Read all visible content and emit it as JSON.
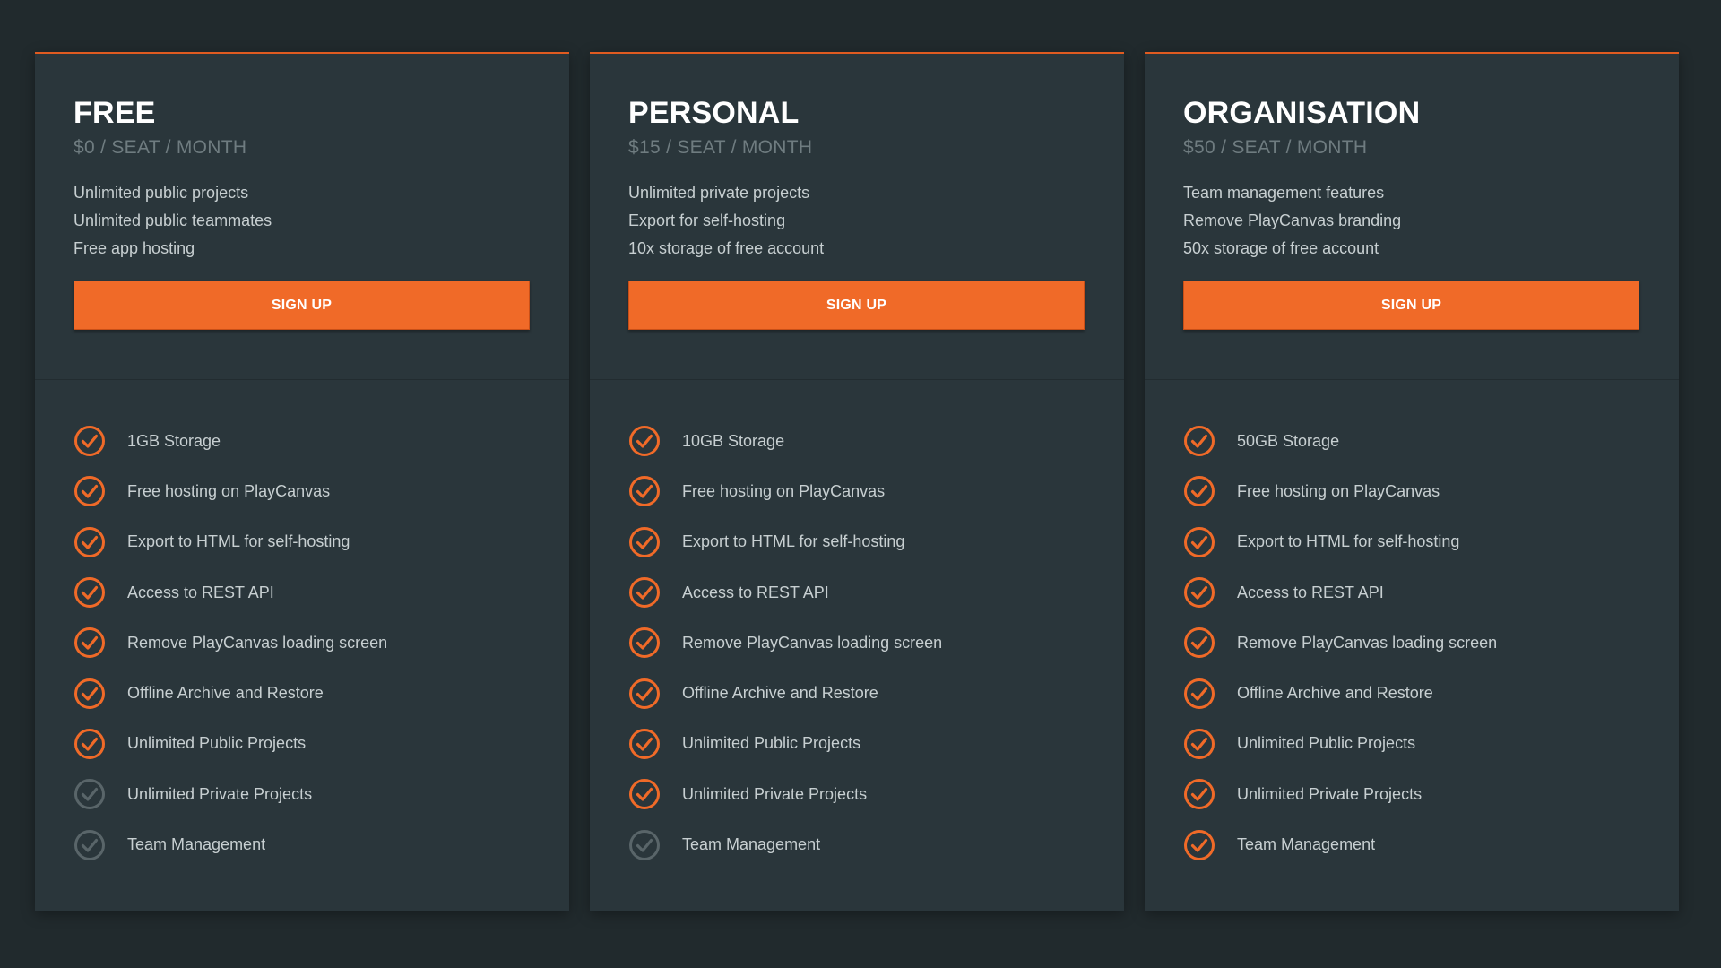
{
  "colors": {
    "background": "#212a2d",
    "card": "#2a363b",
    "accent": "#f06a28",
    "check_included": "#f06a28",
    "check_excluded": "#596569"
  },
  "plans": [
    {
      "name": "FREE",
      "price": "$0 / SEAT / MONTH",
      "highlights": [
        "Unlimited public projects",
        "Unlimited public teammates",
        "Free app hosting"
      ],
      "cta": "SIGN UP",
      "features": [
        {
          "label": "1GB Storage",
          "included": true,
          "icon": "check-circle-icon"
        },
        {
          "label": "Free hosting on PlayCanvas",
          "included": true,
          "icon": "check-circle-icon"
        },
        {
          "label": "Export to HTML for self-hosting",
          "included": true,
          "icon": "check-circle-icon"
        },
        {
          "label": "Access to REST API",
          "included": true,
          "icon": "check-circle-icon"
        },
        {
          "label": "Remove PlayCanvas loading screen",
          "included": true,
          "icon": "check-circle-icon"
        },
        {
          "label": "Offline Archive and Restore",
          "included": true,
          "icon": "check-circle-icon"
        },
        {
          "label": "Unlimited Public Projects",
          "included": true,
          "icon": "check-circle-icon"
        },
        {
          "label": "Unlimited Private Projects",
          "included": false,
          "icon": "check-circle-icon"
        },
        {
          "label": "Team Management",
          "included": false,
          "icon": "check-circle-icon"
        }
      ]
    },
    {
      "name": "PERSONAL",
      "price": "$15 / SEAT / MONTH",
      "highlights": [
        "Unlimited private projects",
        "Export for self-hosting",
        "10x storage of free account"
      ],
      "cta": "SIGN UP",
      "features": [
        {
          "label": "10GB Storage",
          "included": true,
          "icon": "check-circle-icon"
        },
        {
          "label": "Free hosting on PlayCanvas",
          "included": true,
          "icon": "check-circle-icon"
        },
        {
          "label": "Export to HTML for self-hosting",
          "included": true,
          "icon": "check-circle-icon"
        },
        {
          "label": "Access to REST API",
          "included": true,
          "icon": "check-circle-icon"
        },
        {
          "label": "Remove PlayCanvas loading screen",
          "included": true,
          "icon": "check-circle-icon"
        },
        {
          "label": "Offline Archive and Restore",
          "included": true,
          "icon": "check-circle-icon"
        },
        {
          "label": "Unlimited Public Projects",
          "included": true,
          "icon": "check-circle-icon"
        },
        {
          "label": "Unlimited Private Projects",
          "included": true,
          "icon": "check-circle-icon"
        },
        {
          "label": "Team Management",
          "included": false,
          "icon": "check-circle-icon"
        }
      ]
    },
    {
      "name": "ORGANISATION",
      "price": "$50 / SEAT / MONTH",
      "highlights": [
        "Team management features",
        "Remove PlayCanvas branding",
        "50x storage of free account"
      ],
      "cta": "SIGN UP",
      "features": [
        {
          "label": "50GB Storage",
          "included": true,
          "icon": "check-circle-icon"
        },
        {
          "label": "Free hosting on PlayCanvas",
          "included": true,
          "icon": "check-circle-icon"
        },
        {
          "label": "Export to HTML for self-hosting",
          "included": true,
          "icon": "check-circle-icon"
        },
        {
          "label": "Access to REST API",
          "included": true,
          "icon": "check-circle-icon"
        },
        {
          "label": "Remove PlayCanvas loading screen",
          "included": true,
          "icon": "check-circle-icon"
        },
        {
          "label": "Offline Archive and Restore",
          "included": true,
          "icon": "check-circle-icon"
        },
        {
          "label": "Unlimited Public Projects",
          "included": true,
          "icon": "check-circle-icon"
        },
        {
          "label": "Unlimited Private Projects",
          "included": true,
          "icon": "check-circle-icon"
        },
        {
          "label": "Team Management",
          "included": true,
          "icon": "check-circle-icon"
        }
      ]
    }
  ]
}
